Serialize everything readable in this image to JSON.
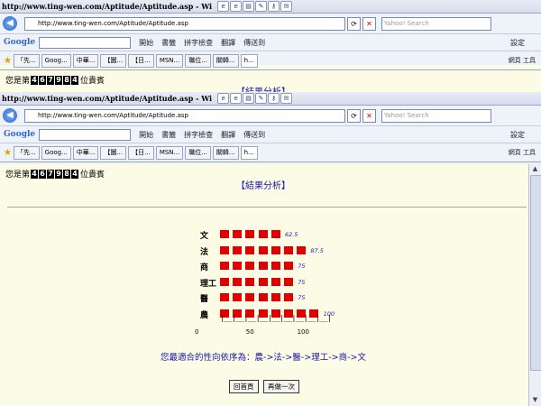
{
  "window1": {
    "title": "http://www.ting-wen.com/Aptitude/Aptitude.asp - Wi",
    "address": "http://www.ting-wen.com/Aptitude/Aptitude.asp",
    "search_placeholder": "Yahoo! Search"
  },
  "window2": {
    "title": "http://www.ting-wen.com/Aptitude/Aptitude.asp - Wi",
    "address": "http://www.ting-wen.com/Aptitude/Aptitude.asp",
    "search_placeholder": "Yahoo! Search"
  },
  "toolbar": {
    "google": "Google",
    "items": [
      "開始",
      "書籤",
      "拼字檢查",
      "翻譯",
      "傳送到"
    ],
    "settings": "設定"
  },
  "tabs1": [
    "「先...",
    "Goog...",
    "中華...",
    "【圖...",
    "【日...",
    "MSN...",
    "職位...",
    "關韓...",
    "h..."
  ],
  "tabs2": [
    "「先...",
    "Goog...",
    "中華...",
    "【圖...",
    "【日...",
    "MSN...",
    "職位...",
    "關韓...",
    "h..."
  ],
  "fav_right": "網頁  工具",
  "page": {
    "counter_prefix": "您是第",
    "counter_suffix": "位貴賓",
    "counter_digits": [
      "4",
      "6",
      "7",
      "9",
      "8",
      "4"
    ],
    "counter_digits2": [
      "4",
      "6",
      "7",
      "9",
      "8",
      "4"
    ],
    "analysis_title": "【結果分析】",
    "result_label": "您最適合的性向依序為：",
    "result_order": "農->法->醫->理工->商->文",
    "buttons": {
      "home": "回首頁",
      "retry": "再做一次"
    }
  },
  "chart_data": {
    "type": "bar",
    "categories": [
      "文",
      "法",
      "商",
      "理工",
      "醫",
      "農"
    ],
    "values": [
      62.5,
      87.5,
      75,
      75,
      75,
      100
    ],
    "value_labels": [
      "62.5",
      "87.5",
      "75",
      "75",
      "75",
      "100"
    ],
    "xlim": [
      0,
      100
    ],
    "ticks": [
      "0",
      "50",
      "100"
    ],
    "bar_color": "#e00000",
    "axis_marks": "|__|__|__|__|__|__|__|__|__|"
  }
}
